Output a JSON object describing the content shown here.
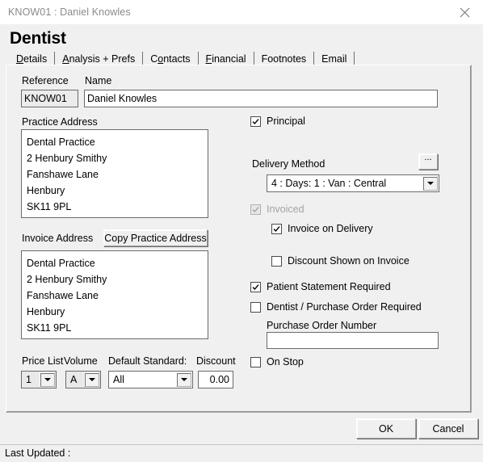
{
  "window": {
    "title": "KNOW01 : Daniel Knowles",
    "close_icon": "close-icon"
  },
  "heading": "Dentist",
  "tabs": [
    {
      "label": "Details",
      "accel": "D",
      "active": true
    },
    {
      "label": "Analysis + Prefs",
      "accel": "A",
      "active": false
    },
    {
      "label": "Contacts",
      "accel": "o",
      "active": false
    },
    {
      "label": "Financial",
      "accel": "F",
      "active": false
    },
    {
      "label": "Footnotes",
      "accel": "",
      "active": false
    },
    {
      "label": "Email",
      "accel": "",
      "active": false
    }
  ],
  "form": {
    "reference_label": "Reference",
    "reference_value": "KNOW01",
    "name_label": "Name",
    "name_value": "Daniel Knowles",
    "practice_address_label": "Practice Address",
    "practice_address": [
      "Dental Practice",
      "2 Henbury Smithy",
      "Fanshawe Lane",
      "Henbury",
      "SK11 9PL"
    ],
    "invoice_address_label": "Invoice Address",
    "copy_practice_address_button": "Copy Practice Address",
    "invoice_address": [
      "Dental Practice",
      "2 Henbury Smithy",
      "Fanshawe Lane",
      "Henbury",
      "SK11 9PL"
    ],
    "price_list_label": "Price List",
    "price_list_value": "1",
    "volume_label": "Volume",
    "volume_value": "A",
    "default_standard_label": "Default Standard:",
    "default_standard_value": "All",
    "discount_label": "Discount",
    "discount_value": "0.00"
  },
  "right": {
    "principal": {
      "label": "Principal",
      "checked": true,
      "disabled": false
    },
    "delivery_method_label": "Delivery Method",
    "delivery_method_value": "4 : Days: 1 : Van : Central",
    "delivery_browse_button": "...",
    "invoiced": {
      "label": "Invoiced",
      "checked": true,
      "disabled": true
    },
    "invoice_on_delivery": {
      "label": "Invoice on Delivery",
      "checked": true,
      "disabled": false
    },
    "discount_shown_on_invoice": {
      "label": "Discount Shown on Invoice",
      "checked": false,
      "disabled": false
    },
    "patient_statement_required": {
      "label": "Patient Statement Required",
      "checked": true,
      "disabled": false
    },
    "dentist_purchase_order_required": {
      "label": "Dentist / Purchase Order Required",
      "checked": false,
      "disabled": false
    },
    "purchase_order_number_label": "Purchase Order Number",
    "purchase_order_number_value": "",
    "on_stop": {
      "label": "On Stop",
      "checked": false,
      "disabled": false
    }
  },
  "footer": {
    "ok_label": "OK",
    "cancel_label": "Cancel"
  },
  "statusbar": {
    "text": "Last Updated :"
  },
  "colors": {
    "dialog_background": "#f0f0f0",
    "field_background": "#ffffff",
    "readonly_field_background": "#ececec",
    "border": "#6b6b6b",
    "disabled_text": "#a4a4a4",
    "titlebar_text": "#8a8a8a"
  }
}
